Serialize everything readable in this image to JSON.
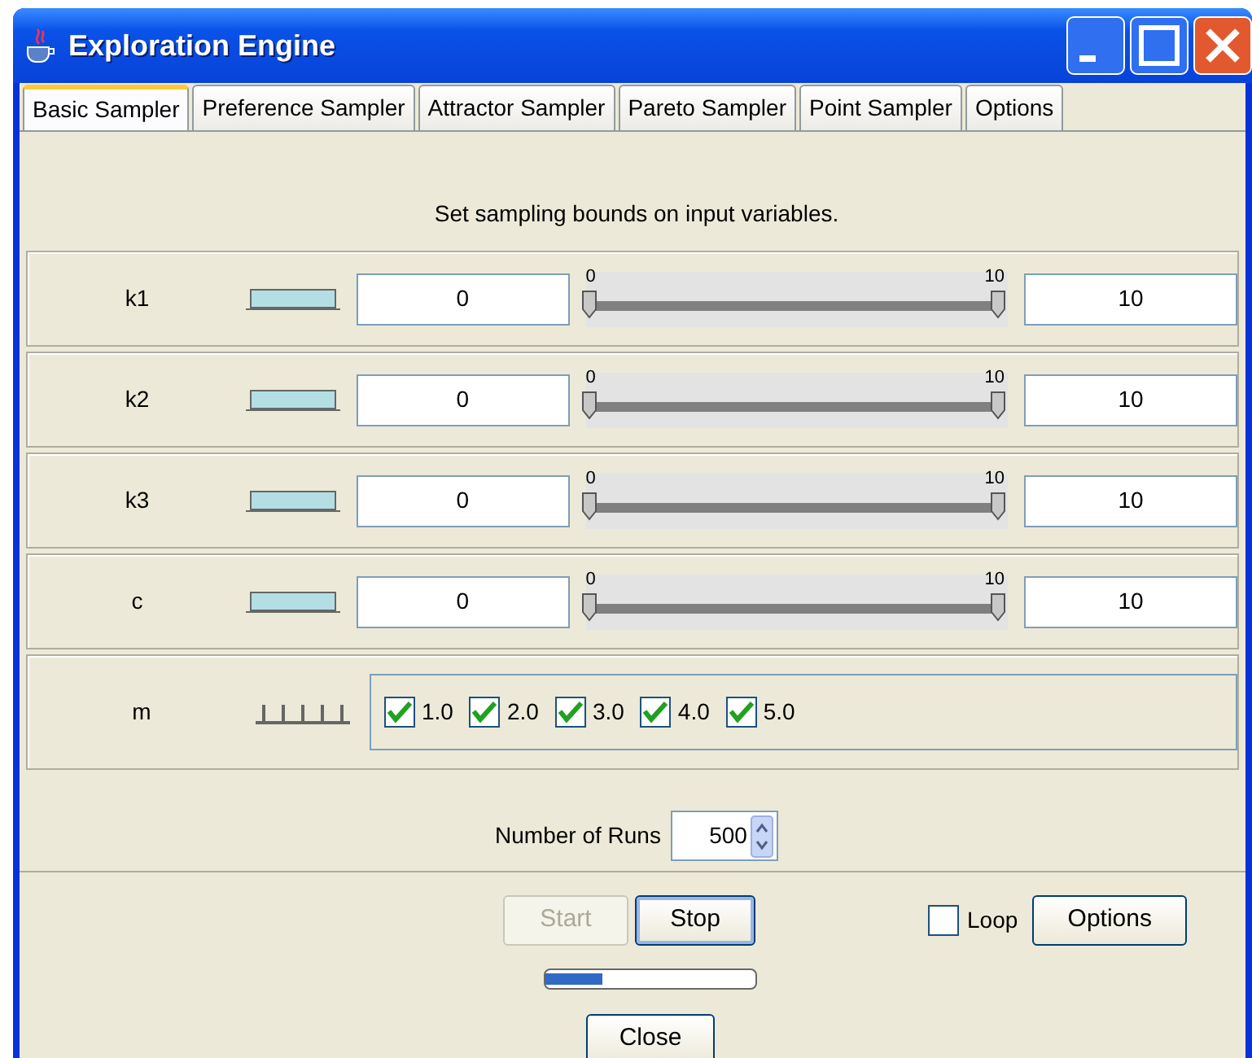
{
  "window": {
    "title": "Exploration Engine"
  },
  "tabs": [
    {
      "label": "Basic Sampler",
      "selected": true
    },
    {
      "label": "Preference Sampler",
      "selected": false
    },
    {
      "label": "Attractor Sampler",
      "selected": false
    },
    {
      "label": "Pareto Sampler",
      "selected": false
    },
    {
      "label": "Point Sampler",
      "selected": false
    },
    {
      "label": "Options",
      "selected": false
    }
  ],
  "instructions": "Set sampling bounds on input variables.",
  "variables": [
    {
      "name": "k1",
      "kind": "continuous",
      "min": "0",
      "max": "10",
      "slider": {
        "min_label": "0",
        "max_label": "10",
        "thumbs": [
          {
            "level": 0
          },
          {
            "level": 1
          }
        ]
      }
    },
    {
      "name": "k2",
      "kind": "continuous",
      "min": "0",
      "max": "10",
      "slider": {
        "min_label": "0",
        "max_label": "10",
        "thumbs": [
          {
            "level": 0
          },
          {
            "level": 1
          }
        ]
      }
    },
    {
      "name": "k3",
      "kind": "continuous",
      "min": "0",
      "max": "10",
      "slider": {
        "min_label": "0",
        "max_label": "10",
        "thumbs": [
          {
            "level": 0
          },
          {
            "level": 1
          }
        ]
      }
    },
    {
      "name": "c",
      "kind": "continuous",
      "min": "0",
      "max": "10",
      "slider": {
        "min_label": "0",
        "max_label": "10",
        "thumbs": [
          {
            "level": 0
          },
          {
            "level": 1
          }
        ]
      }
    },
    {
      "name": "m",
      "kind": "discrete",
      "options": [
        {
          "label": "1.0",
          "checked": true
        },
        {
          "label": "2.0",
          "checked": true
        },
        {
          "label": "3.0",
          "checked": true
        },
        {
          "label": "4.0",
          "checked": true
        },
        {
          "label": "5.0",
          "checked": true
        }
      ]
    }
  ],
  "runs": {
    "label": "Number of Runs",
    "value": "500"
  },
  "buttons": {
    "start": {
      "label": "Start",
      "disabled": true
    },
    "stop": {
      "label": "Stop",
      "disabled": false
    },
    "loop": {
      "label": "Loop",
      "checked": false
    },
    "options": {
      "label": "Options",
      "disabled": false
    },
    "close": {
      "label": "Close",
      "disabled": false
    }
  },
  "progress": {
    "level": 0.27
  }
}
